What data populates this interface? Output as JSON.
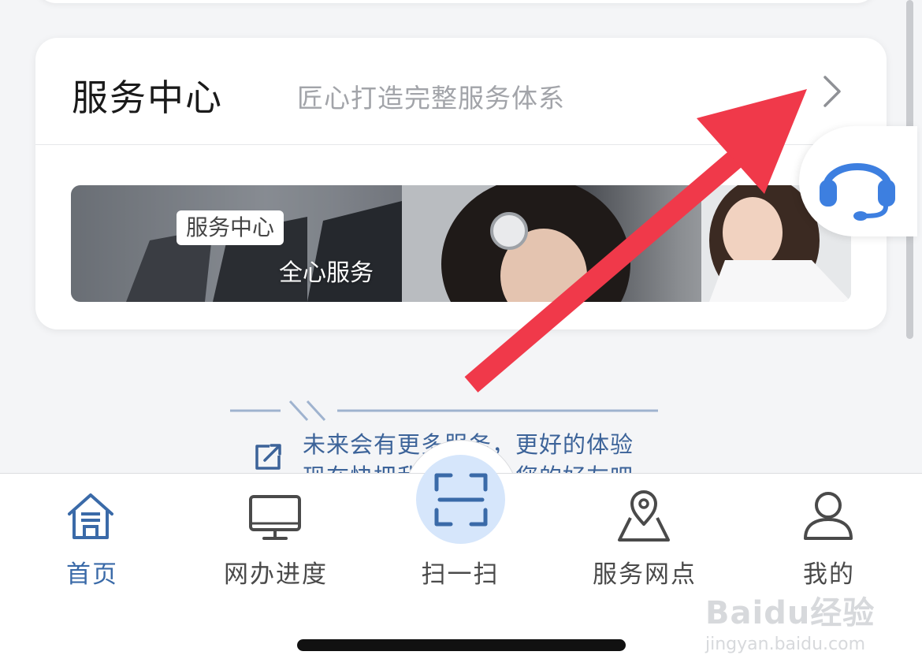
{
  "service_center": {
    "title": "服务中心",
    "subtitle": "匠心打造完整服务体系",
    "banner": {
      "tag": "服务中心",
      "caption": "全心服务"
    }
  },
  "promo": {
    "line1": "未来会有更多服务，更好的体验",
    "line2": "现在快把我们推荐给您的好友吧"
  },
  "tabbar": {
    "items": [
      {
        "label": "首页",
        "icon": "home-icon",
        "active": true
      },
      {
        "label": "网办进度",
        "icon": "monitor-icon",
        "active": false
      },
      {
        "label": "扫一扫",
        "icon": "scan-icon",
        "active": false
      },
      {
        "label": "服务网点",
        "icon": "map-pin-icon",
        "active": false
      },
      {
        "label": "我的",
        "icon": "user-icon",
        "active": false
      }
    ]
  },
  "watermark": {
    "logo": "Baidu经验",
    "url": "jingyan.baidu.com"
  },
  "colors": {
    "accent_blue": "#3a6aa8",
    "scan_bg": "#d6e6fb",
    "support_icon": "#3d7fe0",
    "annotation_arrow": "#f0394a"
  }
}
